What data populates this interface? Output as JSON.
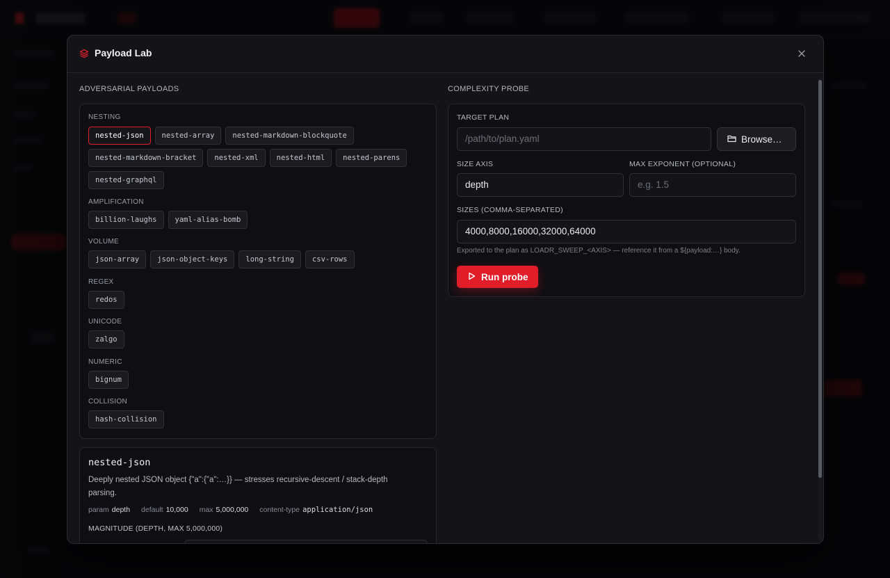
{
  "modal": {
    "title": "Payload Lab",
    "icon": "layers-icon",
    "close_icon": "close-icon"
  },
  "payloads": {
    "section_title": "ADVERSARIAL PAYLOADS",
    "groups": [
      {
        "label": "NESTING",
        "chips": [
          "nested-json",
          "nested-array",
          "nested-markdown-blockquote",
          "nested-markdown-bracket",
          "nested-xml",
          "nested-html",
          "nested-parens",
          "nested-graphql"
        ]
      },
      {
        "label": "AMPLIFICATION",
        "chips": [
          "billion-laughs",
          "yaml-alias-bomb"
        ]
      },
      {
        "label": "VOLUME",
        "chips": [
          "json-array",
          "json-object-keys",
          "long-string",
          "csv-rows"
        ]
      },
      {
        "label": "REGEX",
        "chips": [
          "redos"
        ]
      },
      {
        "label": "UNICODE",
        "chips": [
          "zalgo"
        ]
      },
      {
        "label": "NUMERIC",
        "chips": [
          "bignum"
        ]
      },
      {
        "label": "COLLISION",
        "chips": [
          "hash-collision"
        ]
      }
    ],
    "selected": "nested-json"
  },
  "detail": {
    "name": "nested-json",
    "description": "Deeply nested JSON object {\"a\":{\"a\":…}} — stresses recursive-descent / stack-depth parsing.",
    "param_key": "param",
    "param_val": "depth",
    "default_key": "default",
    "default_val": "10,000",
    "max_key": "max",
    "max_val": "5,000,000",
    "content_type_key": "content-type",
    "content_type_val": "application/json",
    "magnitude_label": "MAGNITUDE (DEPTH, MAX 5,000,000)"
  },
  "probe": {
    "section_title": "COMPLEXITY PROBE",
    "target_plan_label": "TARGET PLAN",
    "target_plan_placeholder": "/path/to/plan.yaml",
    "browse_label": "Browse…",
    "size_axis_label": "SIZE AXIS",
    "size_axis_value": "depth",
    "max_exponent_label": "MAX EXPONENT (OPTIONAL)",
    "max_exponent_placeholder": "e.g. 1.5",
    "sizes_label": "SIZES (COMMA-SEPARATED)",
    "sizes_value": "4000,8000,16000,32000,64000",
    "hint": "Exported to the plan as LOADR_SWEEP_<AXIS> — reference it from a ${payload:…} body.",
    "run_label": "Run probe"
  },
  "colors": {
    "accent": "#e11d2a",
    "background": "#0b0b0e",
    "modal": "#141418"
  }
}
